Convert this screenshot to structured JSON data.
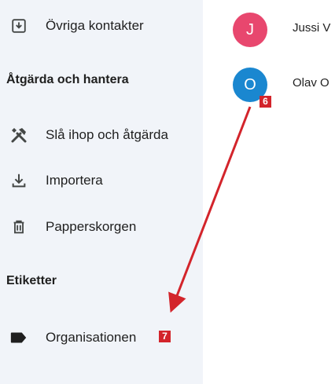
{
  "sidebar": {
    "other_contacts": {
      "label": "Övriga kontakter",
      "icon": "inbox-download-icon"
    },
    "manage_section": {
      "heading": "Åtgärda och hantera",
      "items": [
        {
          "label": "Slå ihop och åtgärda",
          "icon": "tools-icon"
        },
        {
          "label": "Importera",
          "icon": "download-icon"
        },
        {
          "label": "Papperskorgen",
          "icon": "trash-icon"
        }
      ]
    },
    "labels_section": {
      "heading": "Etiketter",
      "items": [
        {
          "label": "Organisationen",
          "icon": "label-tag-icon"
        }
      ]
    }
  },
  "contacts": [
    {
      "initial": "J",
      "name": "Jussi V",
      "avatar_color": "#e8476e"
    },
    {
      "initial": "O",
      "name": "Olav O",
      "avatar_color": "#1a87d0"
    }
  ],
  "annotations": {
    "badge_6": "6",
    "badge_7": "7",
    "color": "#d3242b"
  }
}
